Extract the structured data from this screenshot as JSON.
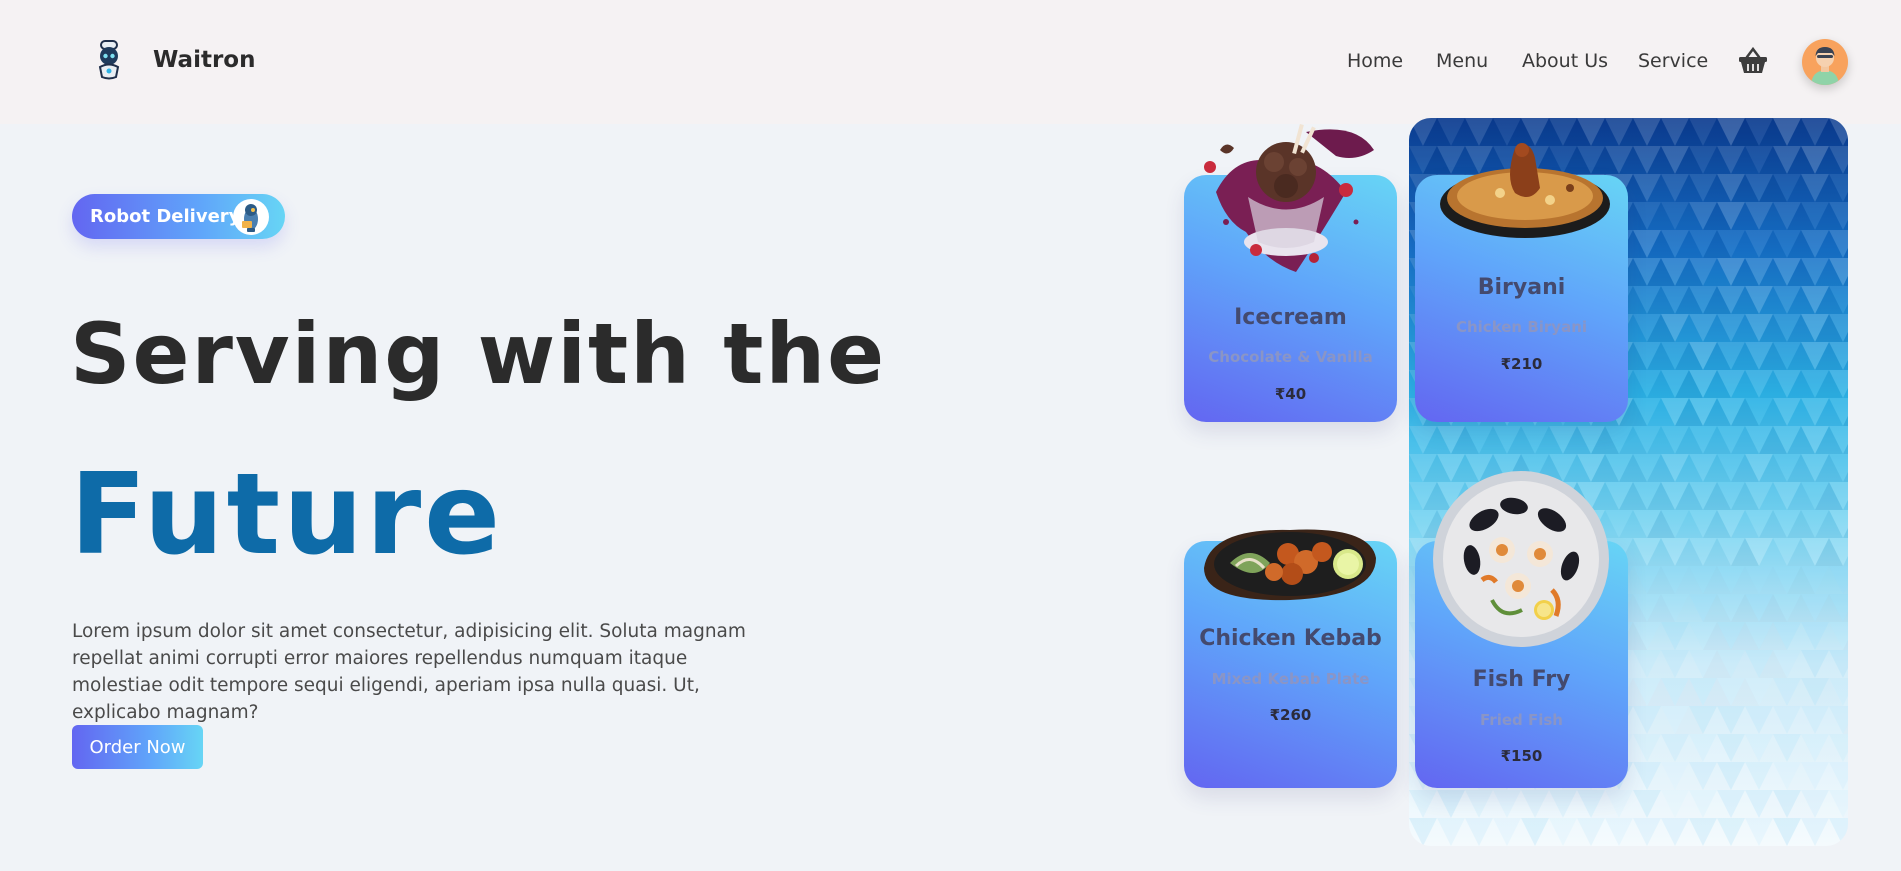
{
  "header": {
    "brand": "Waitron",
    "nav": [
      "Home",
      "Menu",
      "About Us",
      "Service"
    ]
  },
  "hero": {
    "badge": "Robot Delivery",
    "title_line1": "Serving with the",
    "title_line2": "Future",
    "description": "Lorem ipsum dolor sit amet consectetur, adipisicing elit. Soluta magnam repellat animi corrupti error maiores repellendus numquam itaque molestiae odit tempore sequi eligendi, aperiam ipsa nulla quasi. Ut, explicabo magnam?",
    "cta": "Order Now"
  },
  "menu": [
    {
      "name": "Icecream",
      "sub": "Chocolate & Vanilla",
      "price": "₹40"
    },
    {
      "name": "Biryani",
      "sub": "Chicken Biryani",
      "price": "₹210"
    },
    {
      "name": "Chicken Kebab",
      "sub": "Mixed Kebab Plate",
      "price": "₹260"
    },
    {
      "name": "Fish Fry",
      "sub": "Fried Fish",
      "price": "₹150"
    }
  ],
  "colors": {
    "accent": "#0e6ba8",
    "gradient_start": "#6366f1",
    "gradient_end": "#67d5f5"
  }
}
